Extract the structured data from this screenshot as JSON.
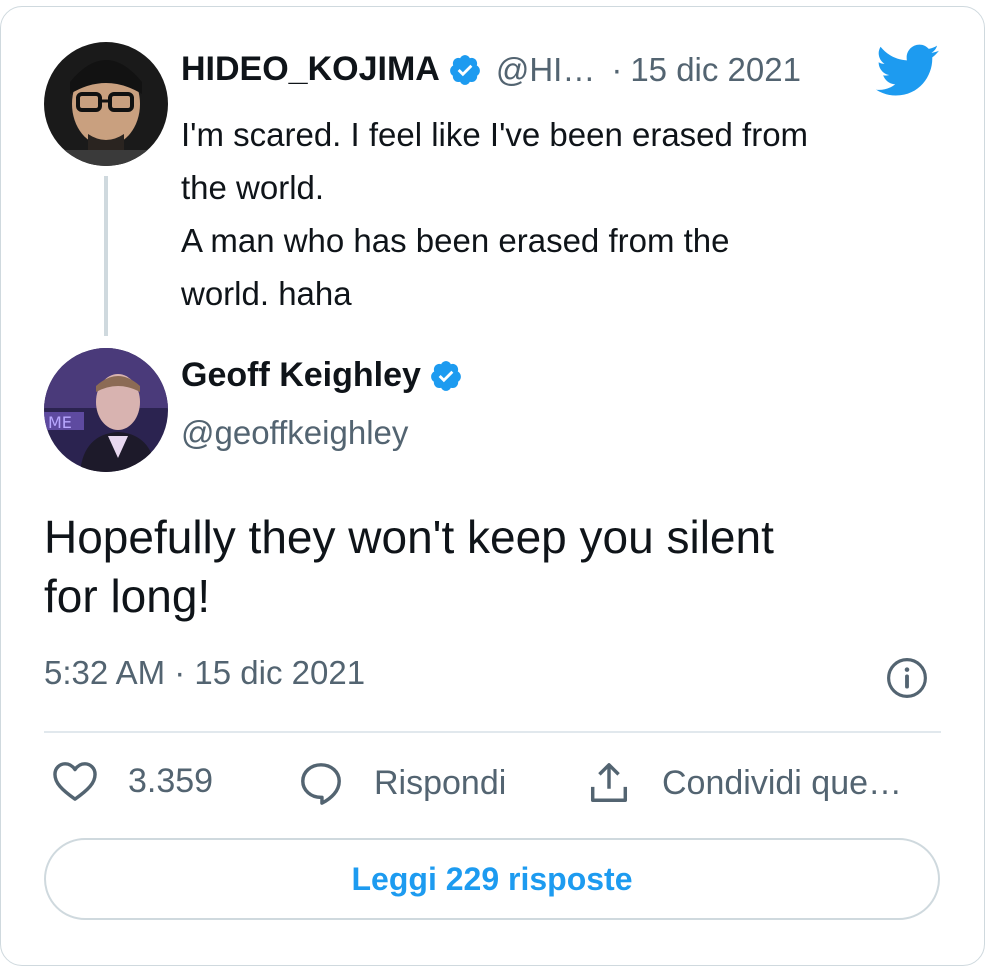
{
  "quoted_tweet": {
    "author_name": "HIDEO_KOJIMA",
    "author_handle": "@HI…",
    "separator": "·",
    "date": "15 dic 2021",
    "text_lines": [
      "I'm scared. I feel like I've been erased from",
      "the world.",
      "A man who has been erased from the",
      "world. haha"
    ]
  },
  "reply_tweet": {
    "author_name": "Geoff Keighley",
    "author_handle": "@geoffkeighley",
    "text_lines": [
      "Hopefully they won't keep you silent",
      "for long!"
    ],
    "timestamp": "5:32 AM · 15 dic 2021"
  },
  "actions": {
    "like_count": "3.359",
    "reply_label": "Rispondi",
    "share_label": "Condividi que…"
  },
  "read_replies_label": "Leggi 229 risposte",
  "icons": {
    "verified": "verified-badge-icon",
    "brand": "twitter-bird-icon",
    "info": "info-icon",
    "like": "heart-icon",
    "reply": "speech-bubble-icon",
    "share": "share-upload-icon"
  },
  "colors": {
    "accent": "#1d9bf0",
    "text_primary": "#0f1419",
    "text_secondary": "#536471",
    "border": "#cfd9de"
  }
}
